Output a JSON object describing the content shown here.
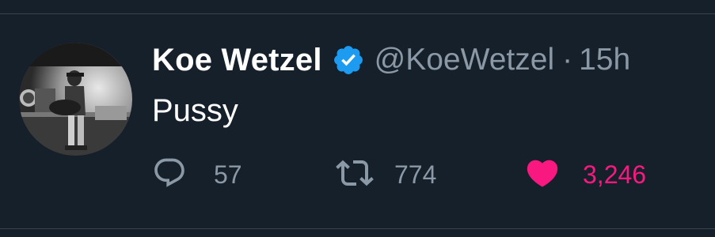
{
  "tweet": {
    "author_name": "Koe Wetzel",
    "handle": "@KoeWetzel",
    "separator": "·",
    "time": "15h",
    "text": "Pussy",
    "verified": true
  },
  "actions": {
    "reply_count": "57",
    "retweet_count": "774",
    "like_count": "3,246",
    "liked": true
  },
  "colors": {
    "background": "#15202b",
    "primary_text": "#ffffff",
    "secondary_text": "#8b98a5",
    "verified_badge": "#1d9bf0",
    "like_active": "#f91880"
  },
  "icons": {
    "verified": "verified-badge-icon",
    "reply": "reply-icon",
    "retweet": "retweet-icon",
    "like": "heart-icon"
  }
}
